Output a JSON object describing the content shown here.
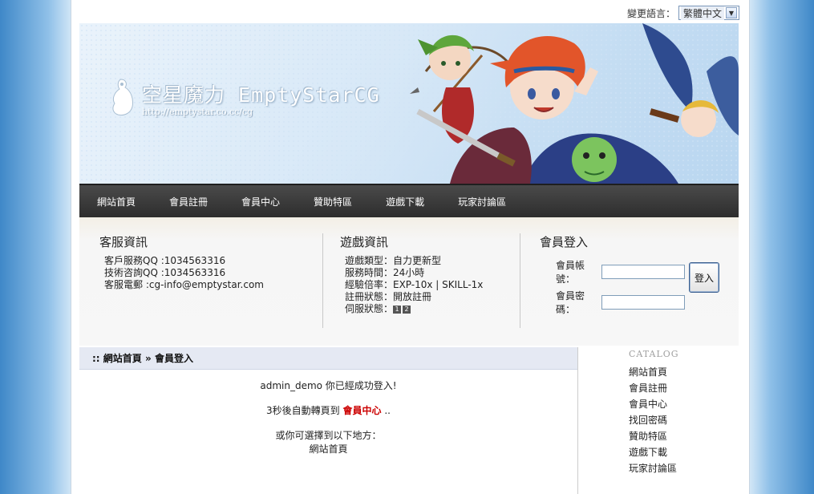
{
  "language": {
    "label": "變更語言：",
    "selected": "繁體中文"
  },
  "brand": {
    "title": "空星魔力 EmptyStarCG",
    "url": "http://emptystar.co.cc/cg"
  },
  "nav": [
    "網站首頁",
    "會員註冊",
    "會員中心",
    "贊助特區",
    "遊戲下載",
    "玩家討論區"
  ],
  "support": {
    "heading": "客服資訊",
    "rows": [
      "客戶服務QQ :1034563316",
      "技術咨詢QQ :1034563316",
      "客服電郵 :cg-info@emptystar.com"
    ]
  },
  "game": {
    "heading": "遊戲資訊",
    "rows": [
      "遊戲類型：自力更新型",
      "服務時間：24小時",
      "經驗倍率：EXP-10x | SKILL-1x",
      "註冊狀態：開放註冊"
    ],
    "server_label": "伺服狀態：",
    "servers": [
      "1",
      "2"
    ]
  },
  "login": {
    "heading": "會員登入",
    "account_label": "會員帳號：",
    "password_label": "會員密碼：",
    "account_value": "",
    "password_value": "",
    "button": "登入"
  },
  "breadcrumb": {
    "prefix": "::",
    "home": "網站首頁",
    "sep": "»",
    "current": "會員登入"
  },
  "message": {
    "success": "admin_demo 你已經成功登入!",
    "redirect_prefix": "3秒後自動轉頁到",
    "redirect_link": "會員中心",
    "redirect_suffix": "..",
    "choose": "或你可選擇到以下地方：",
    "home_link": "網站首頁"
  },
  "catalog": {
    "title": "CATALOG",
    "items": [
      "網站首頁",
      "會員註冊",
      "會員中心",
      "找回密碼",
      "贊助特區",
      "遊戲下載",
      "玩家討論區"
    ]
  },
  "colors": {
    "nav_bg": "#333333",
    "link_red": "#cc0000",
    "breadcrumb_bg": "#e5e9f3"
  }
}
